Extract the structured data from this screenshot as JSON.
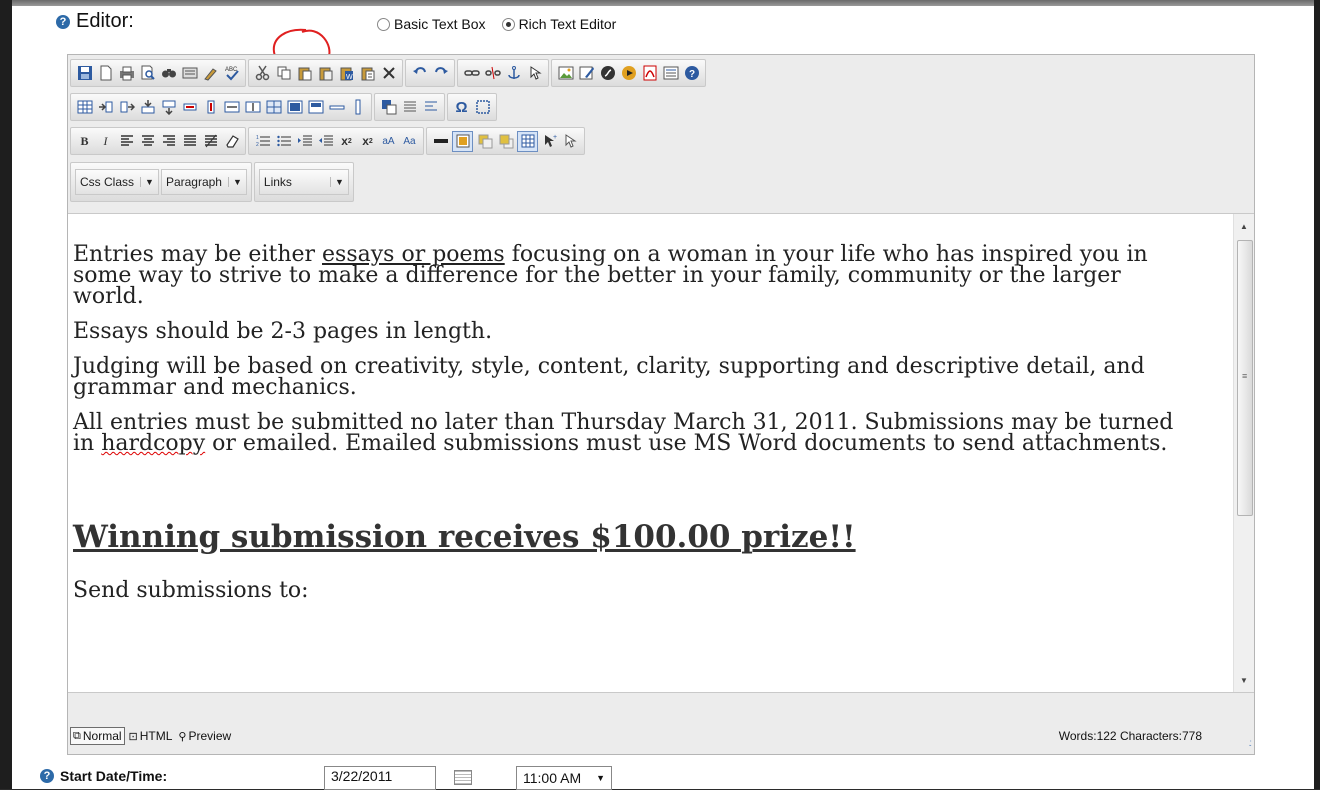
{
  "editor_label": "Editor:",
  "mode_options": [
    {
      "label": "Basic Text Box",
      "selected": false
    },
    {
      "label": "Rich Text Editor",
      "selected": true
    }
  ],
  "dropdowns": {
    "css_class": "Css Class",
    "paragraph": "Paragraph",
    "links": "Links"
  },
  "content": {
    "p1_pre": "Entries may be either ",
    "p1_link": "essays or poems",
    "p1_post": " focusing on a woman in your life who has inspired you in some way to strive to make a difference for the better in your family, community or the larger world.",
    "p2": "Essays should be 2-3 pages in length.",
    "p3": "Judging will be based on creativity, style, content, clarity, supporting and descriptive detail, and grammar and mechanics.",
    "p4_pre": "All entries must be submitted no later than Thursday March 31, 2011. Submissions may be turned in ",
    "p4_misspelled": "hardcopy",
    "p4_post": " or emailed. Emailed submissions must use MS Word documents to send attachments.",
    "prize": "Winning submission receives $100.00 prize!!",
    "p5": "Send submissions to:"
  },
  "status": {
    "normal": "Normal",
    "html": "HTML",
    "preview": "Preview",
    "words_label": "Words:",
    "words": "122",
    "chars_label": "Characters:",
    "chars": "778"
  },
  "start": {
    "label": "Start Date/Time:",
    "date": "3/22/2011",
    "time": "11:00 AM"
  },
  "colors": {
    "accent": "#2d6aa8",
    "annotation": "#e02020"
  }
}
